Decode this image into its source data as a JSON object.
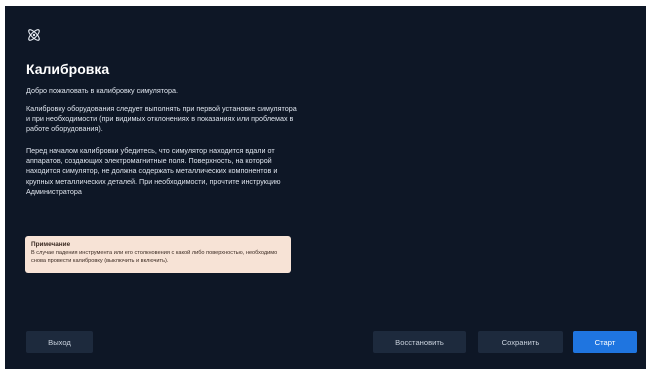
{
  "header": {
    "logo_icon": "atom-icon",
    "title": "Калибровка"
  },
  "content": {
    "paragraph1": "Добро пожаловать в калибровку симулятора.",
    "paragraph2": "Калибровку оборудования следует выполнять при первой установке симулятора и при необходимости (при видимых отклонениях в показаниях или проблемах в работе оборудования).",
    "paragraph3": "Перед началом калибровки убедитесь, что симулятор находится вдали от аппаратов, создающих электромагнитные поля. Поверхность, на которой находится симулятор, не должна содержать металлических компонентов и крупных металлических деталей. При необходимости, прочтите инструкцию Администратора"
  },
  "note": {
    "title": "Примечание",
    "text": "В случае падения инструмента или его столкновения с какой либо поверхностью, необходимо снова провести калибровку (выключить и включить)."
  },
  "buttons": {
    "exit": "Выход",
    "restore": "Восстановить",
    "save": "Сохранить",
    "start": "Старт"
  },
  "colors": {
    "background": "#0e1726",
    "button": "#1d2a3d",
    "accent": "#1f75e0",
    "note_background": "#f7e3d6"
  }
}
